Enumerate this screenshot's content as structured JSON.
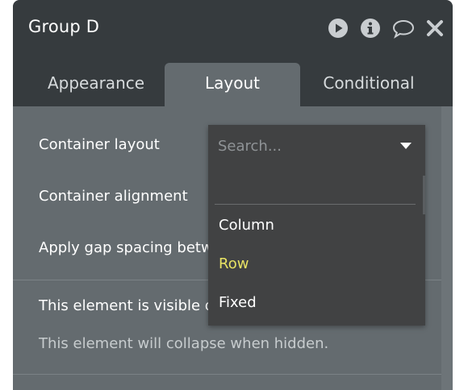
{
  "header": {
    "title": "Group D",
    "icons": [
      "play-icon",
      "info-icon",
      "comment-icon",
      "close-icon"
    ]
  },
  "tabs": [
    {
      "label": "Appearance",
      "active": false
    },
    {
      "label": "Layout",
      "active": true
    },
    {
      "label": "Conditional",
      "active": false
    }
  ],
  "fields": {
    "container_layout": "Container layout",
    "container_alignment": "Container alignment",
    "gap_spacing": "Apply gap spacing betw",
    "visible_on_load": "This element is visible o",
    "collapse_hint": "This element will collapse when hidden."
  },
  "dropdown": {
    "placeholder": "Search...",
    "options": [
      {
        "label": "Column",
        "selected": false
      },
      {
        "label": "Row",
        "selected": true
      },
      {
        "label": "Fixed",
        "selected": false
      }
    ]
  },
  "colors": {
    "header_bg": "#363b3e",
    "panel_bg": "#646b6f",
    "dropdown_bg": "#414243",
    "selected_option": "#e8e364"
  }
}
